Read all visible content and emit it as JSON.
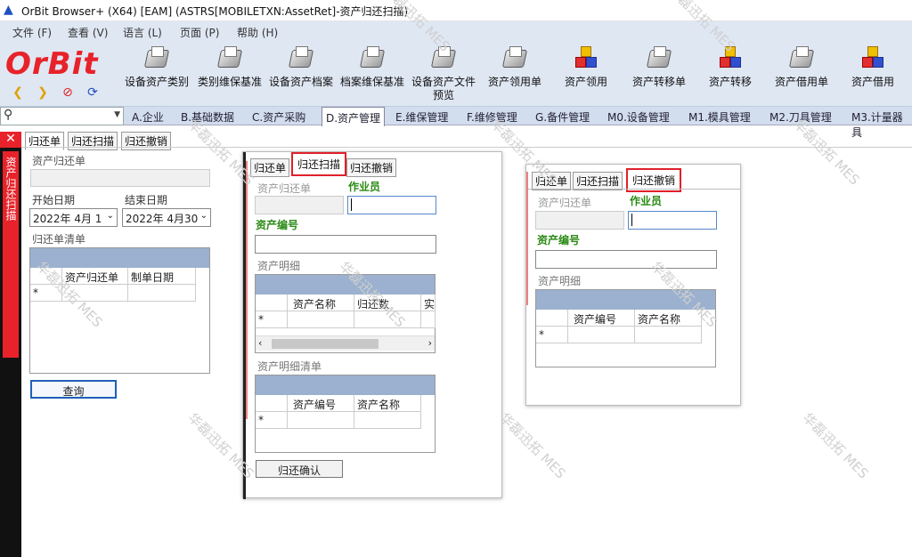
{
  "window": {
    "title": "OrBit Browser+ (X64) [EAM] (ASTRS[MOBILETXN:AssetRet]-资产归还扫描)"
  },
  "menu": [
    "文件 (F)",
    "查看 (V)",
    "语言 (L)",
    "页面 (P)",
    "帮助 (H)"
  ],
  "logo": "OrBit",
  "toolbar": [
    {
      "label": "设备资产类别",
      "icon": "disk"
    },
    {
      "label": "类别维保基准",
      "icon": "disk"
    },
    {
      "label": "设备资产档案",
      "icon": "disk"
    },
    {
      "label": "档案维保基准",
      "icon": "disk"
    },
    {
      "label": "设备资产文件预览",
      "icon": "disk"
    },
    {
      "label": "资产领用单",
      "icon": "disk"
    },
    {
      "label": "资产领用",
      "icon": "cube"
    },
    {
      "label": "资产转移单",
      "icon": "disk"
    },
    {
      "label": "资产转移",
      "icon": "cube"
    },
    {
      "label": "资产借用单",
      "icon": "disk"
    },
    {
      "label": "资产借用",
      "icon": "cube"
    }
  ],
  "nav_icons": [
    "back-icon",
    "forward-icon",
    "stop-icon",
    "refresh-icon"
  ],
  "module_tabs": [
    "A.企业",
    "B.基础数据",
    "C.资产采购",
    "D.资产管理",
    "E.维保管理",
    "F.维修管理",
    "G.备件管理",
    "M0.设备管理",
    "M1.模具管理",
    "M2.刀具管理",
    "M3.计量器具"
  ],
  "active_module": "D.资产管理",
  "side_tab": "资产归还扫描",
  "page_tabs": [
    "归还单",
    "归还扫描",
    "归还撤销"
  ],
  "left": {
    "doc_label": "资产归还单",
    "start_label": "开始日期",
    "end_label": "结束日期",
    "start_value": "2022年  4月  1",
    "end_value": "2022年  4月30",
    "list_label": "归还单清单",
    "grid_cols": [
      "资产归还单",
      "制单日期"
    ],
    "query_btn": "查询"
  },
  "scan": {
    "doc_label": "资产归还单",
    "operator_label": "作业员",
    "asset_label": "资产编号",
    "detail_label": "资产明细",
    "detail_cols": [
      "资产名称",
      "归还数",
      "实"
    ],
    "detail_list_label": "资产明细清单",
    "detail_list_cols": [
      "资产编号",
      "资产名称"
    ],
    "confirm_btn": "归还确认"
  },
  "cancel": {
    "doc_label": "资产归还单",
    "operator_label": "作业员",
    "asset_label": "资产编号",
    "detail_label": "资产明细",
    "detail_cols": [
      "资产编号",
      "资产名称"
    ]
  },
  "new_row_marker": "*",
  "watermark": "华磊迅拓 MES",
  "colors": {
    "brand_red": "#e8222a",
    "grid_header": "#9bb1cf",
    "label_green": "#2a8a14",
    "highlight": "#e0202a"
  }
}
